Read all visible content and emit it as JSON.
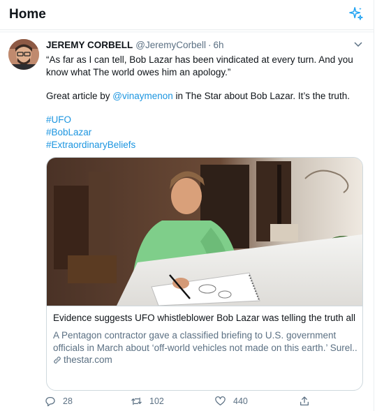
{
  "header": {
    "title": "Home",
    "sparkle_icon": "sparkle-icon"
  },
  "tweet": {
    "author_name": "JEREMY CORBELL",
    "author_handle": "@JeremyCorbell",
    "separator": "·",
    "time": "6h",
    "text_line1": "“As far as I can tell, Bob Lazar has been vindicated at every turn. And you",
    "text_line2": "know what The world owes him an apology.”",
    "text_line3_before": "Great article by ",
    "mention": "@vinaymenon",
    "text_line3_after": " in The Star about Bob Lazar. It’s the truth.",
    "hashtags": [
      "#UFO",
      "#BobLazar",
      "#ExtraordinaryBeliefs"
    ],
    "card": {
      "title": "Evidence suggests UFO whistleblower Bob Lazar was telling the truth all ...",
      "description_line1": "A Pentagon contractor gave a classified briefing to U.S. government",
      "description_line2": "officials in March about ‘off-world vehicles not made on this earth.’ Surel...",
      "domain": "thestar.com"
    },
    "actions": {
      "replies": "28",
      "retweets": "102",
      "likes": "440"
    }
  },
  "colors": {
    "accent": "#1da1f2",
    "link": "#1b95e0",
    "muted": "#5b7083",
    "border": "#cfd9de"
  }
}
